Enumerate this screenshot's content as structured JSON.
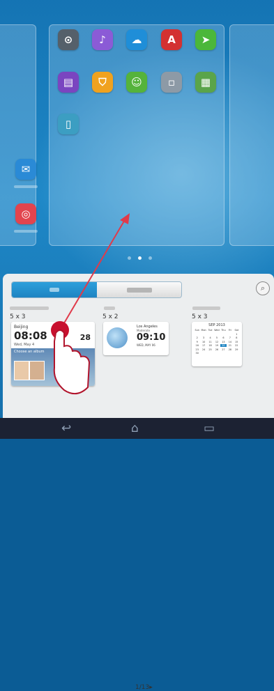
{
  "launcher": {
    "page_count": 3,
    "active_page": 2
  },
  "apps": [
    {
      "icon": "steering-wheel-icon",
      "color": "#55606a",
      "glyph": "⊙"
    },
    {
      "icon": "microphone-icon",
      "color": "#8b5bd6",
      "glyph": "♪"
    },
    {
      "icon": "weather-icon",
      "color": "#1f8ed8",
      "glyph": "☁"
    },
    {
      "icon": "dictionary-icon",
      "color": "#d33131",
      "glyph": "A"
    },
    {
      "icon": "navigation-icon",
      "color": "#4bb73a",
      "glyph": "➤"
    },
    {
      "icon": "reader-icon",
      "color": "#7a45c0",
      "glyph": "▤"
    },
    {
      "icon": "security-shield-icon",
      "color": "#f0a21f",
      "glyph": "⛉"
    },
    {
      "icon": "contacts-icon",
      "color": "#55b33c",
      "glyph": "☺"
    },
    {
      "icon": "tools-folder-icon",
      "color": "#8d9aa6",
      "glyph": "▫"
    },
    {
      "icon": "apps-folder-icon",
      "color": "#5aa44a",
      "glyph": "▦"
    },
    {
      "icon": "phone-manager-icon",
      "color": "#3c9ec2",
      "glyph": "▯"
    },
    {
      "icon": "email-icon",
      "color": "#2a8ad6",
      "glyph": "✉"
    },
    {
      "icon": "camera-icon",
      "color": "#e2444e",
      "glyph": "◎"
    }
  ],
  "widget_panel": {
    "tab_widgets": "",
    "tab_other": "",
    "widgets": [
      {
        "size": "5 x 3",
        "city": "Beijing",
        "time": "08:08",
        "temp": "28",
        "date": "Wed, May 4",
        "album_text": "Choose an album"
      },
      {
        "size": "5 x 2",
        "city": "Los Angeles",
        "subtitle": "Moderate",
        "time": "09:10",
        "date": "WED, MAY 06"
      },
      {
        "size": "5 x 3",
        "month": "SEP 2013",
        "weekdays": [
          "Sun",
          "Mon",
          "Tue",
          "Wed",
          "Thu",
          "Fri",
          "Sat"
        ],
        "days": [
          "",
          "",
          "",
          "",
          "",
          "",
          "1",
          "2",
          "3",
          "4",
          "5",
          "6",
          "7",
          "8",
          "9",
          "10",
          "11",
          "12",
          "13",
          "14",
          "15",
          "16",
          "17",
          "18",
          "19",
          "20",
          "21",
          "22",
          "23",
          "24",
          "25",
          "26",
          "27",
          "28",
          "29",
          "30"
        ],
        "highlight_day": "20"
      }
    ],
    "pager": "1/13"
  },
  "colors": {
    "accent": "#1e84c2",
    "arrow": "#e03a4a"
  }
}
